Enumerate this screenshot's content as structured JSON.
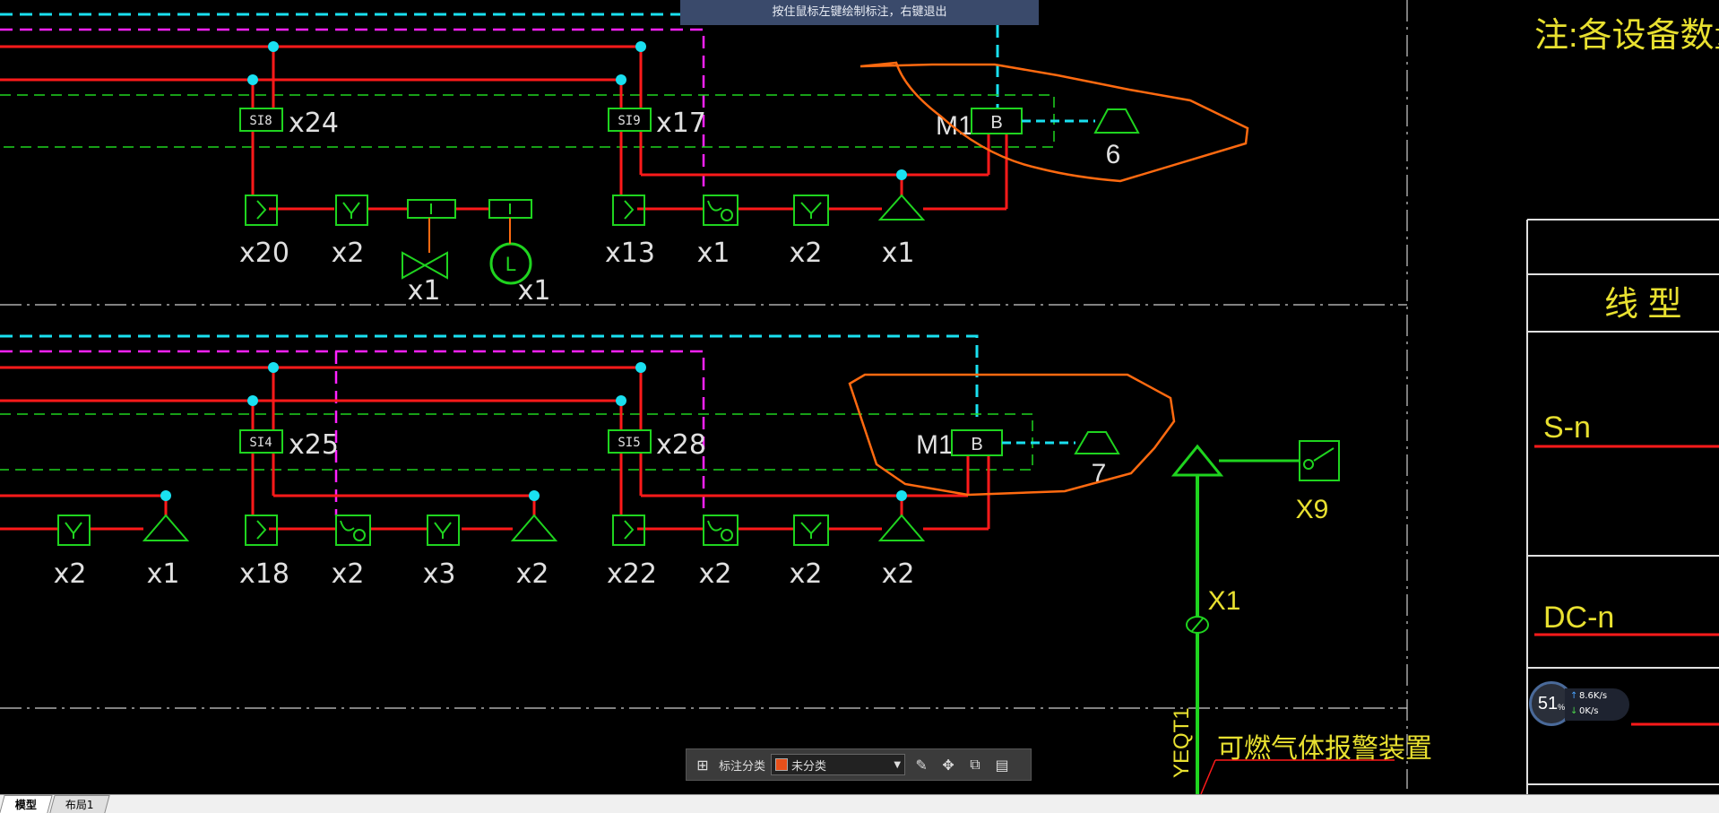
{
  "hint": {
    "text": "按住鼠标左键绘制标注，右键退出"
  },
  "note": {
    "text": "注:各设备数量见"
  },
  "legend": {
    "header": "线  型",
    "row1": "S-n",
    "row2": "DC-n"
  },
  "alarm_device": {
    "label": "可燃气体报警装置",
    "vertical_label": "YEQT1",
    "x1": "X1",
    "x9": "X9"
  },
  "top_section": {
    "boxes": [
      {
        "tag": "SI8",
        "count": "x24"
      },
      {
        "tag": "SI9",
        "count": "x17"
      }
    ],
    "counts": [
      "x20",
      "x2",
      "x1",
      "x1",
      "x13",
      "x1",
      "x2",
      "x1"
    ],
    "m_label": "M1",
    "b_label": "B",
    "annot_number": "6",
    "l_symbol": "L",
    "i_symbol": "I"
  },
  "bottom_section": {
    "boxes": [
      {
        "tag": "SI4",
        "count": "x25"
      },
      {
        "tag": "SI5",
        "count": "x28"
      }
    ],
    "counts": [
      "x2",
      "x1",
      "x18",
      "x2",
      "x3",
      "x2",
      "x22",
      "x2",
      "x2",
      "x2"
    ],
    "m_label": "M1",
    "b_label": "B",
    "annot_number": "7"
  },
  "toolbar": {
    "category_label": "标注分类",
    "category_value": "未分类",
    "category_color": "#e8501a"
  },
  "tabs": [
    {
      "label": "模型"
    },
    {
      "label": "布局1"
    }
  ],
  "net": {
    "percent": "51",
    "percent_unit": "%",
    "up": "8.6K/s",
    "down": "0K/s"
  },
  "colors": {
    "red": "#ff1a1a",
    "green": "#1fd41f",
    "cyan": "#1ae0f0",
    "magenta": "#ff22ff",
    "yellow": "#e8e030",
    "orange": "#ff6a10",
    "white": "#e0e0e0"
  }
}
